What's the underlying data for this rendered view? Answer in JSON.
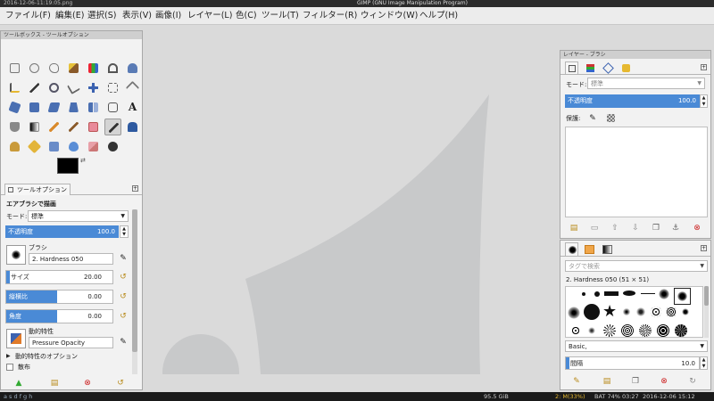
{
  "window": {
    "file_label": "2016-12-06-11:19:05.png",
    "title": "GIMP (GNU Image Manipulation Program)"
  },
  "menu": [
    "ファイル(F)",
    "編集(E)",
    "選択(S)",
    "表示(V)",
    "画像(I)",
    "レイヤー(L)",
    "色(C)",
    "ツール(T)",
    "フィルター(R)",
    "ウィンドウ(W)",
    "ヘルプ(H)"
  ],
  "toolbox": {
    "title": "ツールボックス - ツールオプション",
    "tab_label": "ツールオプション",
    "tool_name": "エアブラシで描画",
    "mode_label": "モード:",
    "mode_value": "標準",
    "opacity_label": "不透明度",
    "opacity_value": "100.0",
    "brush_label": "ブラシ",
    "brush_name": "2. Hardness 050",
    "size_label": "サイズ",
    "size_value": "20.00",
    "aspect_label": "縦横比",
    "aspect_value": "0.00",
    "angle_label": "角度",
    "angle_value": "0.00",
    "dynamics_label": "動的特性",
    "dynamics_value": "Pressure Opacity",
    "dynamics_options": "動的特性のオプション",
    "scatter_label": "散布"
  },
  "layers": {
    "title": "レイヤー - ブラシ",
    "mode_label": "モード:",
    "mode_value": "標準",
    "opacity_label": "不透明度",
    "opacity_value": "100.0",
    "lock_label": "保護:"
  },
  "brushes": {
    "tag_placeholder": "タグで検索",
    "brush_info": "2. Hardness 050 (51 × 51)",
    "preset": "Basic,",
    "spacing_label": "間隔",
    "spacing_value": "10.0"
  },
  "status": {
    "workspaces": "a s d f g h",
    "disk": "95.5 GiB",
    "mem": "2: M(33%)",
    "battery": "BAT 74% 03:27",
    "datetime": "2016-12-06 15:12"
  },
  "colors": {
    "accent": "#4a8ad6",
    "canvas_shape": "#c8c9ca"
  }
}
